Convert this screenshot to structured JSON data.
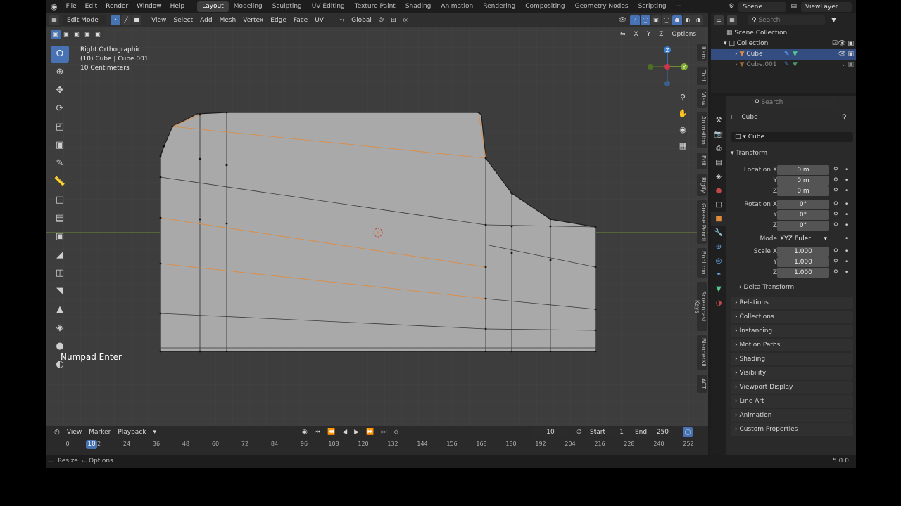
{
  "topbar": {
    "menus": [
      "File",
      "Edit",
      "Render",
      "Window",
      "Help"
    ],
    "workspaces": [
      "Layout",
      "Modeling",
      "Sculpting",
      "UV Editing",
      "Texture Paint",
      "Shading",
      "Animation",
      "Rendering",
      "Compositing",
      "Geometry Nodes",
      "Scripting"
    ],
    "active_workspace": "Layout",
    "add_label": "+",
    "scene": "Scene",
    "view_layer": "ViewLayer"
  },
  "viewport_header": {
    "mode": "Edit Mode",
    "menus": [
      "View",
      "Select",
      "Add",
      "Mesh",
      "Vertex",
      "Edge",
      "Face",
      "UV"
    ],
    "orientation": "Global",
    "axes": [
      "X",
      "Y",
      "Z"
    ],
    "options": "Options"
  },
  "overlay_text": {
    "view_name": "Right Orthographic",
    "object_info": "(10) Cube | Cube.001",
    "scale": "10 Centimeters"
  },
  "keystroke": "Numpad Enter",
  "gizmo": {
    "z": "Z",
    "y": "Y"
  },
  "side_tabs": [
    "Item",
    "Tool",
    "View",
    "Animation",
    "Edit",
    "Rigify",
    "Grease Pencil",
    "Booltron",
    "Screencast Keys",
    "BlenderKit",
    "ACT"
  ],
  "outliner": {
    "search_placeholder": "Search",
    "scene_collection": "Scene Collection",
    "collection": "Collection",
    "items": [
      {
        "name": "Cube",
        "selected": true
      },
      {
        "name": "Cube.001",
        "selected": false
      }
    ]
  },
  "properties": {
    "search_placeholder": "Search",
    "object_name": "Cube",
    "data_name": "Cube",
    "transform_label": "Transform",
    "location_label": "Location X",
    "rotation_label": "Rotation X",
    "mode_label": "Mode",
    "scale_label": "Scale X",
    "axis_y": "Y",
    "axis_z": "Z",
    "location": [
      "0 m",
      "0 m",
      "0 m"
    ],
    "rotation": [
      "0°",
      "0°",
      "0°"
    ],
    "rotation_mode": "XYZ Euler",
    "scale": [
      "1.000",
      "1.000",
      "1.000"
    ],
    "delta_transform": "Delta Transform",
    "panels": [
      "Relations",
      "Collections",
      "Instancing",
      "Motion Paths",
      "Shading",
      "Visibility",
      "Viewport Display",
      "Line Art",
      "Animation",
      "Custom Properties"
    ]
  },
  "timeline": {
    "menus": [
      "View",
      "Marker",
      "Playback"
    ],
    "current_frame": "10",
    "start_label": "Start",
    "start": "1",
    "end_label": "End",
    "end": "250",
    "ruler": [
      "0",
      "12",
      "24",
      "36",
      "48",
      "60",
      "72",
      "84",
      "96",
      "108",
      "120",
      "132",
      "144",
      "156",
      "168",
      "180",
      "192",
      "204",
      "216",
      "228",
      "240",
      "252"
    ],
    "playhead": "10"
  },
  "status": {
    "left_action": "Resize",
    "left_action2": "Options",
    "version": "5.0.0"
  },
  "colors": {
    "accent": "#4772b3",
    "mesh_fill": "#a9a9a9",
    "edge_selected": "#e08a3c",
    "active_item": "#334d80"
  }
}
